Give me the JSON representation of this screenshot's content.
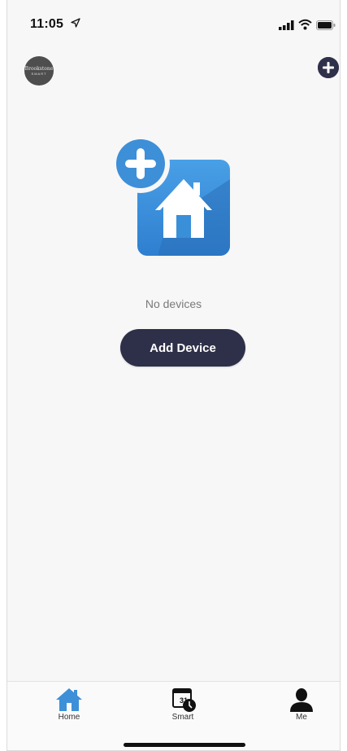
{
  "status_bar": {
    "time": "11:05"
  },
  "header": {
    "logo_line1": "Brookstone",
    "logo_line2": "SMART",
    "add_button_icon": "plus-circle-icon"
  },
  "empty_state": {
    "illustration": "add-home-icon",
    "message": "No devices",
    "add_device_label": "Add Device"
  },
  "tabs": [
    {
      "label": "Home",
      "icon": "home-icon",
      "active": true
    },
    {
      "label": "Smart",
      "icon": "calendar-clock-icon",
      "active": false
    },
    {
      "label": "Me",
      "icon": "person-icon",
      "active": false
    }
  ],
  "colors": {
    "accent_blue": "#3d8fd8",
    "dark_navy": "#2e2f48",
    "background": "#f7f7f7"
  }
}
